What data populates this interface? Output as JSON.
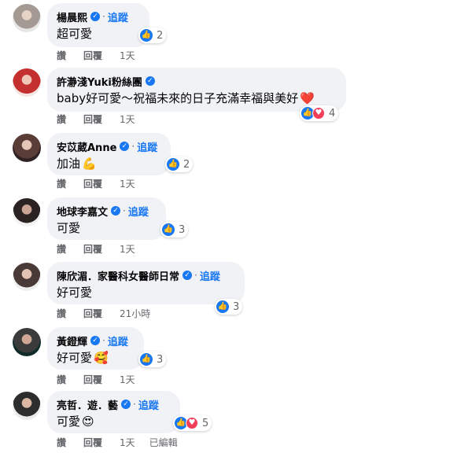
{
  "ui": {
    "follow_label": "追蹤",
    "like_label": "讚",
    "reply_label": "回覆",
    "edited_label": "已編輯"
  },
  "comments": [
    {
      "author": "楊晨熙",
      "text": "超可愛",
      "emoji": "",
      "reactions": [
        "like"
      ],
      "reaction_count": "2",
      "time": "1天",
      "edited": false
    },
    {
      "author": "許瀞淺Yuki粉絲團",
      "text": "baby好可愛～祝福未來的日子充滿幸福與美好",
      "emoji": "❤️",
      "reactions": [
        "like",
        "love"
      ],
      "reaction_count": "4",
      "time": "1天",
      "edited": false
    },
    {
      "author": "安苡葳Anne",
      "text": "加油",
      "emoji": "💪",
      "reactions": [
        "like"
      ],
      "reaction_count": "2",
      "time": "1天",
      "edited": false
    },
    {
      "author": "地球李嘉文",
      "text": "可愛",
      "emoji": "",
      "reactions": [
        "like"
      ],
      "reaction_count": "3",
      "time": "1天",
      "edited": false
    },
    {
      "author": "陳欣湄．家醫科女醫師日常",
      "text": "好可愛",
      "emoji": "",
      "reactions": [
        "like"
      ],
      "reaction_count": "3",
      "time": "21小時",
      "edited": false
    },
    {
      "author": "黃鐙輝",
      "text": "好可愛",
      "emoji": "🥰",
      "reactions": [
        "like"
      ],
      "reaction_count": "3",
      "time": "1天",
      "edited": false
    },
    {
      "author": "亮哲．遊．藝",
      "text": "可愛",
      "emoji": "😍",
      "reactions": [
        "like",
        "love"
      ],
      "reaction_count": "5",
      "time": "1天",
      "edited": true
    }
  ]
}
